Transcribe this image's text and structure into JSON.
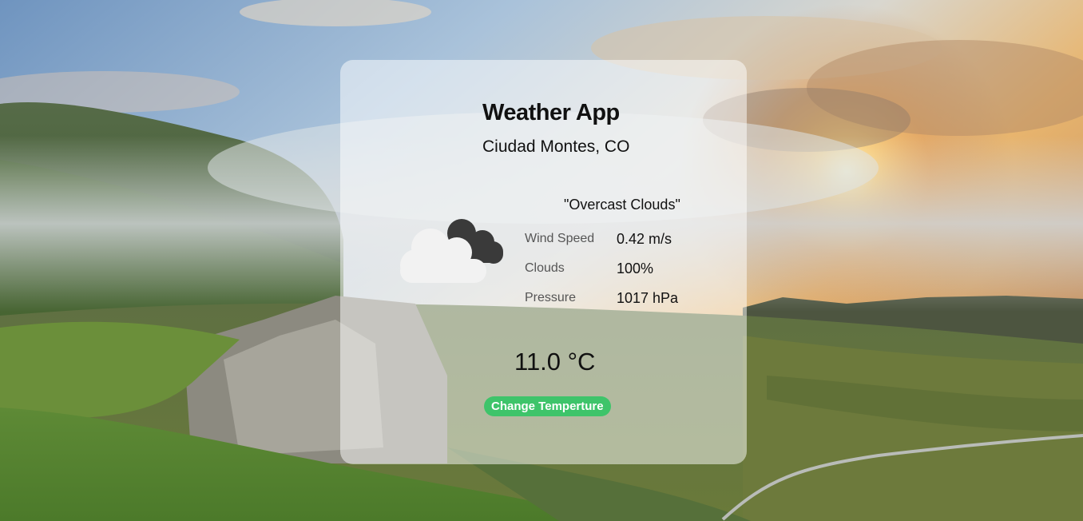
{
  "app": {
    "title": "Weather App",
    "location": "Ciudad Montes, CO"
  },
  "current": {
    "description": "\"Overcast Clouds\"",
    "icon": "overcast-clouds-icon",
    "temperature": "11.0 °C"
  },
  "stats": [
    {
      "label": "Wind Speed",
      "value": "0.42 m/s"
    },
    {
      "label": "Clouds",
      "value": "100%"
    },
    {
      "label": "Pressure",
      "value": "1017 hPa"
    }
  ],
  "actions": {
    "change_temperature_label": "Change Temperture"
  },
  "colors": {
    "button": "#3ec46a",
    "card": "rgba(255,255,255,0.5)",
    "text": "#111111"
  }
}
